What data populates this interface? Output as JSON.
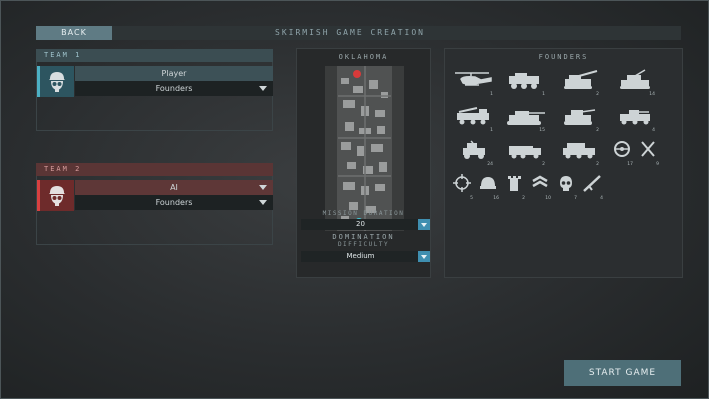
{
  "header": {
    "back_label": "BACK",
    "title": "SKIRMISH  GAME CREATION"
  },
  "teams": [
    {
      "header": "TEAM 1",
      "player": "Player",
      "faction": "Founders",
      "color": "#4cb0c4"
    },
    {
      "header": "TEAM 2",
      "player": "AI",
      "faction": "Founders",
      "color": "#d84040"
    }
  ],
  "map": {
    "name": "OKLAHOMA",
    "mode": "DOMINATION",
    "duration_label": "MISSION DURATION",
    "duration_value": "20",
    "difficulty_label": "DIFFICULTY",
    "difficulty_value": "Medium"
  },
  "units_panel": {
    "title": "FOUNDERS",
    "units": [
      {
        "icon": "helicopter-icon",
        "count": "1"
      },
      {
        "icon": "armored-truck-icon",
        "count": "1"
      },
      {
        "icon": "artillery-icon",
        "count": "2"
      },
      {
        "icon": "anti-air-tank-icon",
        "count": "14"
      },
      {
        "icon": "missile-truck-icon",
        "count": "1"
      },
      {
        "icon": "battle-tank-icon",
        "count": "15"
      },
      {
        "icon": "light-tank-icon",
        "count": "2"
      },
      {
        "icon": "ifv-icon",
        "count": "4"
      },
      {
        "icon": "jeep-icon",
        "count": "24"
      },
      {
        "icon": "supply-truck-icon",
        "count": "2"
      },
      {
        "icon": "rocket-launcher-icon",
        "count": "2"
      },
      {
        "icon": "steering-wheel-icon",
        "count": "17"
      },
      {
        "icon": "tools-icon",
        "count": "9"
      },
      {
        "icon": "crosshair-icon",
        "count": "5"
      },
      {
        "icon": "helmet-icon",
        "count": "16"
      },
      {
        "icon": "tower-icon",
        "count": "2"
      },
      {
        "icon": "chevron-rank-icon",
        "count": "10"
      },
      {
        "icon": "skull-icon",
        "count": "7"
      },
      {
        "icon": "rifle-icon",
        "count": "4"
      }
    ]
  },
  "actions": {
    "start_label": "START GAME"
  }
}
